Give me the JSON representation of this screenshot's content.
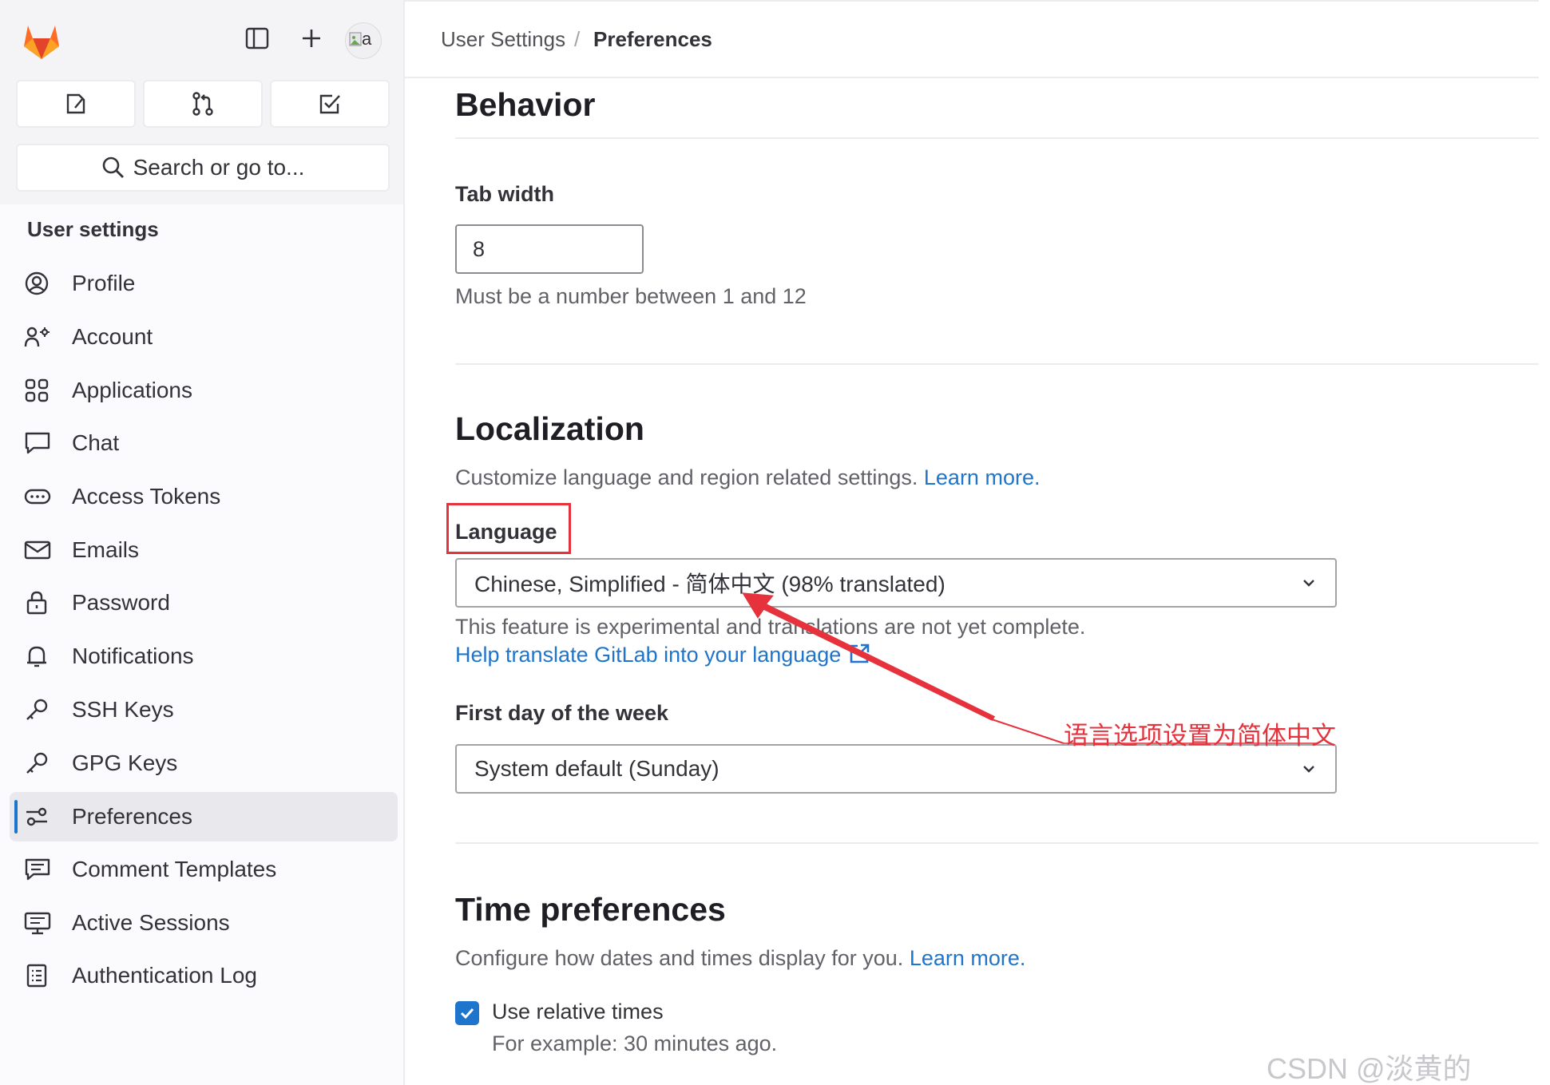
{
  "sidebar": {
    "search_label": "Search or go to...",
    "avatar_text": "a",
    "section_title": "User settings",
    "items": [
      {
        "label": "Profile",
        "icon": "profile-icon"
      },
      {
        "label": "Account",
        "icon": "account-icon"
      },
      {
        "label": "Applications",
        "icon": "applications-icon"
      },
      {
        "label": "Chat",
        "icon": "chat-icon"
      },
      {
        "label": "Access Tokens",
        "icon": "token-icon"
      },
      {
        "label": "Emails",
        "icon": "mail-icon"
      },
      {
        "label": "Password",
        "icon": "lock-icon"
      },
      {
        "label": "Notifications",
        "icon": "bell-icon"
      },
      {
        "label": "SSH Keys",
        "icon": "key-icon"
      },
      {
        "label": "GPG Keys",
        "icon": "key-icon"
      },
      {
        "label": "Preferences",
        "icon": "preferences-icon",
        "active": true
      },
      {
        "label": "Comment Templates",
        "icon": "comment-icon"
      },
      {
        "label": "Active Sessions",
        "icon": "monitor-icon"
      },
      {
        "label": "Authentication Log",
        "icon": "log-icon"
      }
    ]
  },
  "breadcrumb": {
    "parent": "User Settings",
    "separator": "/",
    "current": "Preferences"
  },
  "behavior": {
    "title": "Behavior",
    "tab_width_label": "Tab width",
    "tab_width_value": "8",
    "tab_width_help": "Must be a number between 1 and 12"
  },
  "localization": {
    "title": "Localization",
    "description": "Customize language and region related settings.",
    "learn_more": "Learn more.",
    "language_label": "Language",
    "language_value": "Chinese, Simplified - 简体中文 (98% translated)",
    "experimental_note": "This feature is experimental and translations are not yet complete.",
    "help_translate_link": "Help translate GitLab into your language",
    "first_day_label": "First day of the week",
    "first_day_value": "System default (Sunday)"
  },
  "time_preferences": {
    "title": "Time preferences",
    "description": "Configure how dates and times display for you.",
    "learn_more": "Learn more.",
    "relative_times_label": "Use relative times",
    "relative_times_checked": true,
    "relative_times_example": "For example: 30 minutes ago."
  },
  "annotation": {
    "text": "语言选项设置为简体中文",
    "color": "#e5323d"
  },
  "watermark": "CSDN @淡黄的Cherry",
  "colors": {
    "link": "#1f75cb",
    "active_bg": "#e8e8ed",
    "annotation": "#e5323d"
  }
}
